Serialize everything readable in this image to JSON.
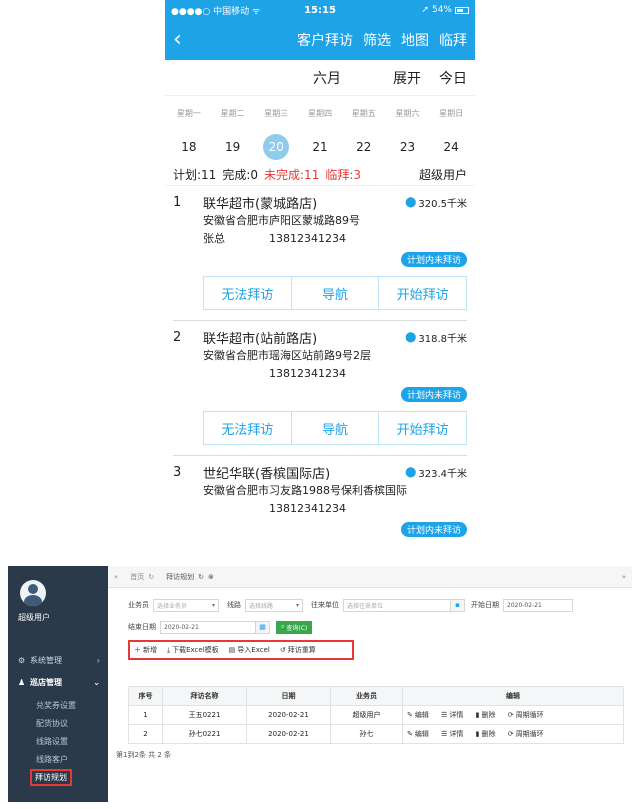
{
  "mobile": {
    "status": {
      "carrier": "●●●●○ 中国移动 ᯤ",
      "time": "15:15",
      "battery": "54%"
    },
    "nav": {
      "back": "‹",
      "items": [
        "客户拜访",
        "筛选",
        "地图",
        "临拜"
      ]
    },
    "calendar": {
      "month": "六月",
      "expand": "展开",
      "today": "今日",
      "weekdays": [
        "星期一",
        "星期二",
        "星期三",
        "星期四",
        "星期五",
        "星期六",
        "星期日"
      ],
      "dates": [
        "18",
        "19",
        "20",
        "21",
        "22",
        "23",
        "24"
      ],
      "selected_index": 2
    },
    "summary": {
      "plan": "计划:11",
      "done": "完成:0",
      "undone": "未完成:11",
      "temp": "临拜:3",
      "role": "超级用户"
    },
    "visits": [
      {
        "num": "1",
        "name": "联华超市(蒙城路店)",
        "distance": "320.5千米",
        "address": "安徽省合肥市庐阳区蒙城路89号",
        "contact": "张总",
        "phone": "13812341234",
        "tag": "计划内未拜访",
        "actions": [
          "无法拜访",
          "导航",
          "开始拜访"
        ]
      },
      {
        "num": "2",
        "name": "联华超市(站前路店)",
        "distance": "318.8千米",
        "address": "安徽省合肥市瑶海区站前路9号2层",
        "contact": "",
        "phone": "13812341234",
        "tag": "计划内未拜访",
        "actions": [
          "无法拜访",
          "导航",
          "开始拜访"
        ]
      },
      {
        "num": "3",
        "name": "世纪华联(香槟国际店)",
        "distance": "323.4千米",
        "address": "安徽省合肥市习友路1988号保利香槟国际",
        "contact": "",
        "phone": "13812341234",
        "tag": "计划内未拜访"
      }
    ]
  },
  "admin": {
    "user": "超级用户",
    "menu": {
      "system": "系统管理",
      "store": "巡店管理",
      "subs": [
        "兑奖券设置",
        "配货协议",
        "线路设置",
        "线路客户",
        "拜访规划"
      ]
    },
    "tabs": {
      "home": "首页",
      "current": "拜访规划"
    },
    "filters": {
      "salesman_label": "业务员",
      "salesman_placeholder": "选择业务员",
      "route_label": "线路",
      "route_placeholder": "选择线路",
      "unit_label": "往来单位",
      "unit_placeholder": "选择往来单位",
      "start_label": "开始日期",
      "start_value": "2020-02-21",
      "end_label": "结束日期",
      "end_value": "2020-02-21",
      "query": "查询(C)"
    },
    "toolbar": [
      "新增",
      "下载Excel模板",
      "导入Excel",
      "拜访重算"
    ],
    "table": {
      "headers": [
        "序号",
        "拜访名称",
        "日期",
        "业务员",
        "编辑"
      ],
      "rows": [
        {
          "idx": "1",
          "name": "王五0221",
          "date": "2020-02-21",
          "salesman": "超级用户"
        },
        {
          "idx": "2",
          "name": "孙七0221",
          "date": "2020-02-21",
          "salesman": "孙七"
        }
      ],
      "ops": [
        "编辑",
        "详情",
        "删除",
        "周期循环"
      ]
    },
    "pager": "第1到2条 共 2 条"
  }
}
